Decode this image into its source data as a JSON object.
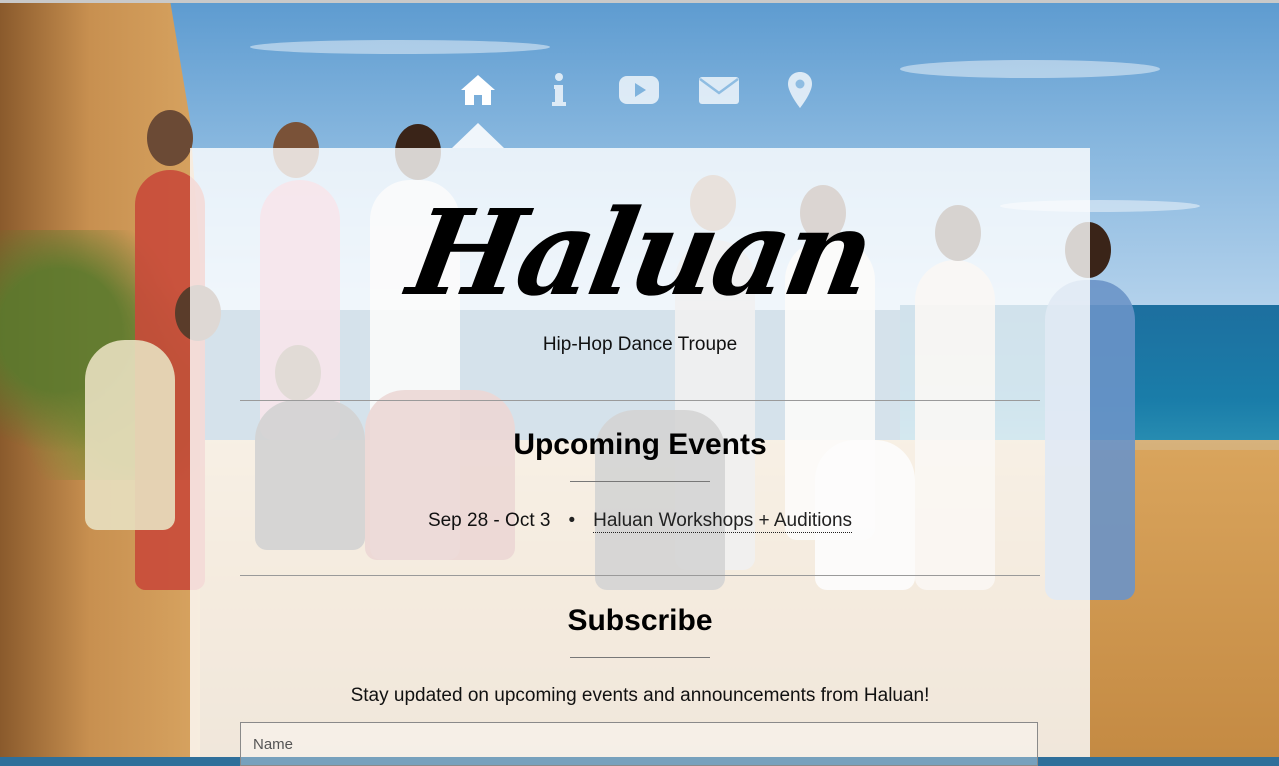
{
  "nav": {
    "items": [
      {
        "icon": "home-icon",
        "active": true
      },
      {
        "icon": "info-icon",
        "active": false
      },
      {
        "icon": "youtube-icon",
        "active": false
      },
      {
        "icon": "envelope-icon",
        "active": false
      },
      {
        "icon": "map-marker-icon",
        "active": false
      }
    ]
  },
  "header": {
    "logo": "Haluan",
    "tagline": "Hip-Hop Dance Troupe"
  },
  "events": {
    "title": "Upcoming Events",
    "items": [
      {
        "date": "Sep 28 - Oct 3",
        "separator": "•",
        "name": "Haluan Workshops + Auditions"
      }
    ]
  },
  "subscribe": {
    "title": "Subscribe",
    "description": "Stay updated on upcoming events and announcements from Haluan!",
    "name_placeholder": "Name"
  },
  "colors": {
    "panel": "#ffffff",
    "nav_icon": "#ffffff",
    "text": "#111111"
  }
}
